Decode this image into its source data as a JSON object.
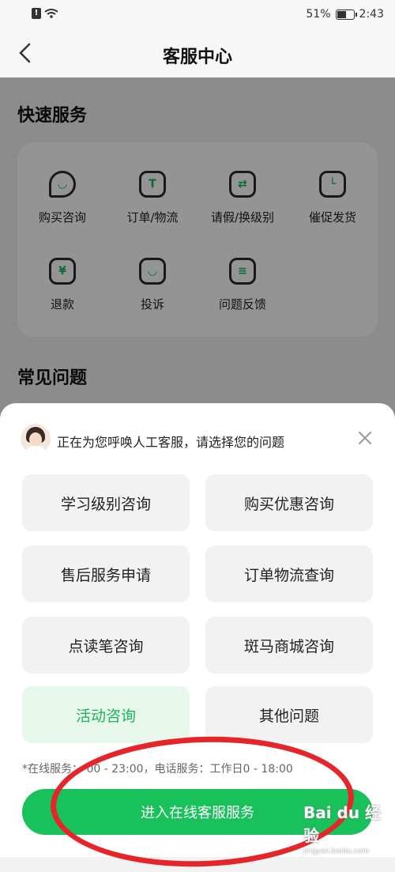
{
  "status_bar": {
    "battery": "51%",
    "time": "2:43"
  },
  "header": {
    "title": "客服中心"
  },
  "quick_services": {
    "title": "快速服务",
    "items": [
      {
        "label": "购买咨询",
        "icon": "chat-bubble-icon",
        "glyph": "◡"
      },
      {
        "label": "订单/物流",
        "icon": "order-icon",
        "glyph": "T"
      },
      {
        "label": "请假/换级别",
        "icon": "swap-icon",
        "glyph": "⇄"
      },
      {
        "label": "催促发货",
        "icon": "clock-icon",
        "glyph": "└"
      },
      {
        "label": "退款",
        "icon": "yen-icon",
        "glyph": "¥"
      },
      {
        "label": "投诉",
        "icon": "complaint-icon",
        "glyph": "◡"
      },
      {
        "label": "问题反馈",
        "icon": "feedback-icon",
        "glyph": "≡"
      }
    ]
  },
  "faq": {
    "title": "常见问题"
  },
  "sheet": {
    "prompt": "正在为您呼唤人工客服，请选择您的问题",
    "options": [
      {
        "label": "学习级别咨询"
      },
      {
        "label": "购买优惠咨询"
      },
      {
        "label": "售后服务申请"
      },
      {
        "label": "订单物流查询"
      },
      {
        "label": "点读笔咨询"
      },
      {
        "label": "斑马商城咨询"
      },
      {
        "label": "活动咨询",
        "selected": true
      },
      {
        "label": "其他问题"
      }
    ],
    "hours": "*在线服务：      00 - 23:00，电话服务：工作日0      - 18:00",
    "cta": "进入在线客服服务"
  },
  "watermark": {
    "brand": "Bai du 经验",
    "url": "jingyan.baidu.com"
  },
  "colors": {
    "accent": "#18c15a",
    "selected_bg": "#e8f7ec",
    "annotation": "#e6252a"
  }
}
